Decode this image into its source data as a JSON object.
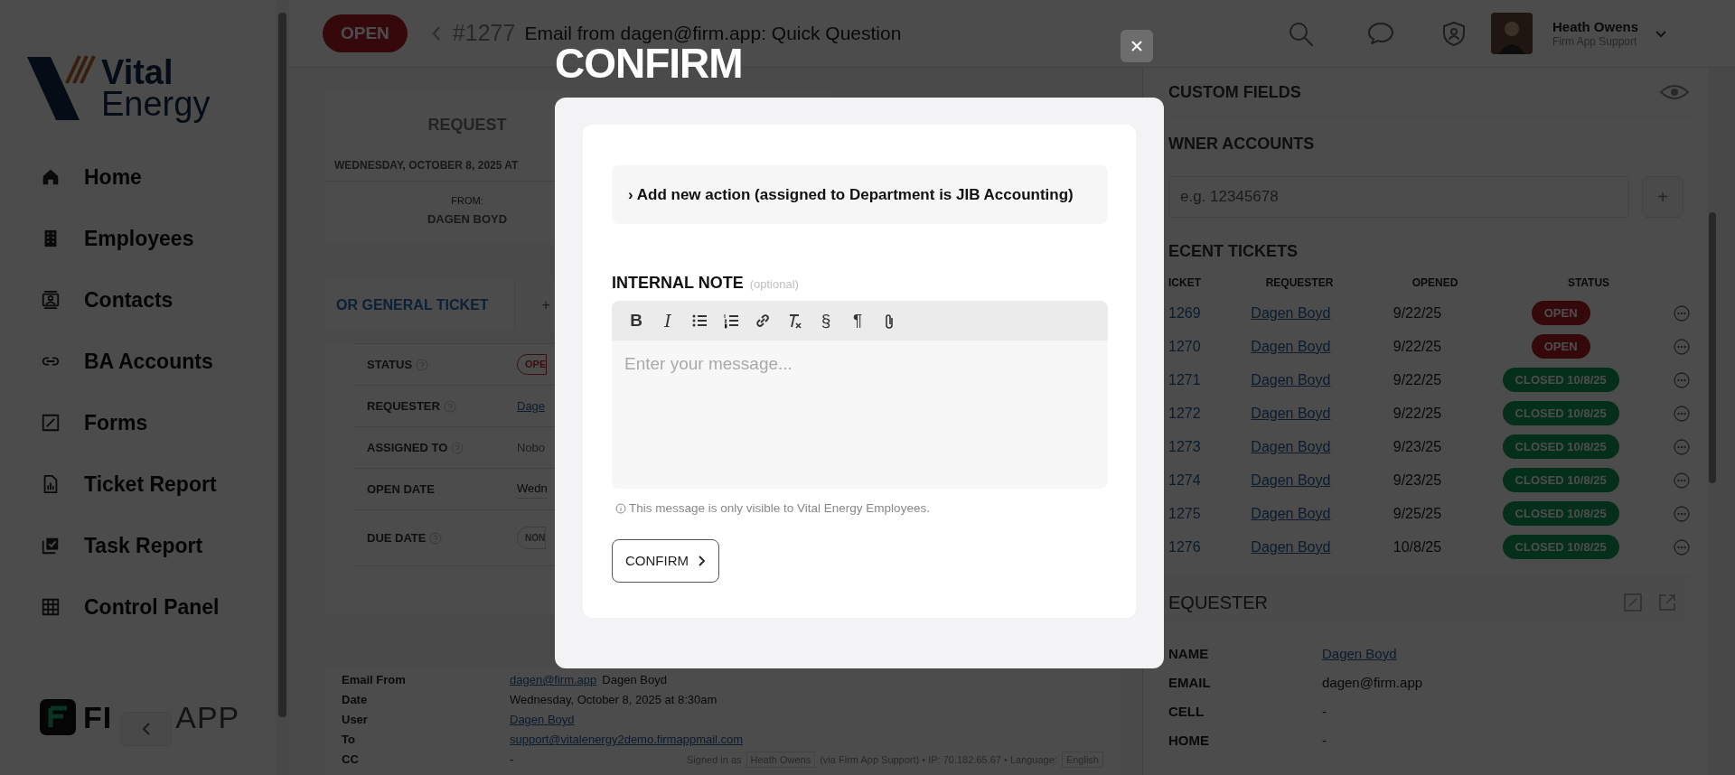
{
  "sidebar": {
    "logo": {
      "line_1": "Vital",
      "line_2": "Energy"
    },
    "items": [
      {
        "label": "Home"
      },
      {
        "label": "Employees"
      },
      {
        "label": "Contacts"
      },
      {
        "label": "BA Accounts"
      },
      {
        "label": "Forms"
      },
      {
        "label": "Ticket Report"
      },
      {
        "label": "Task Report"
      },
      {
        "label": "Control Panel"
      }
    ],
    "footer_logo": {
      "part_1": "FI",
      "part_2": "APP"
    }
  },
  "header": {
    "status": "OPEN",
    "ticket_number": "#1277",
    "title": "Email from dagen@firm.app: Quick Question",
    "user": {
      "name": "Heath Owens",
      "subtitle": "Firm App Support"
    }
  },
  "request": {
    "heading": "REQUEST",
    "date": "WEDNESDAY, OCTOBER 8, 2025 AT",
    "from_label": "FROM:",
    "from": "DAGEN BOYD"
  },
  "tabs": [
    {
      "label": "OR GENERAL TICKET",
      "selected": true
    },
    {
      "label": "+",
      "selected": false
    }
  ],
  "details": [
    {
      "label": "STATUS",
      "help": true,
      "kind": "status",
      "value": "OPE"
    },
    {
      "label": "REQUESTER",
      "help": true,
      "kind": "link",
      "value": "Dage"
    },
    {
      "label": "ASSIGNED TO",
      "help": true,
      "kind": "muted",
      "value": "Nobo"
    },
    {
      "label": "OPEN DATE",
      "help": false,
      "kind": "text",
      "value": "Wedn"
    },
    {
      "label": "DUE DATE",
      "help": true,
      "kind": "pill",
      "value": "NON"
    }
  ],
  "email_meta": [
    {
      "label": "Email From",
      "link": "dagen@firm.app",
      "value": "Dagen Boyd"
    },
    {
      "label": "Date",
      "value": "Wednesday, October 8, 2025 at 8:30am"
    },
    {
      "label": "User",
      "link": "Dagen Boyd"
    },
    {
      "label": "To",
      "link": "support@vitalenergy2demo.firmappmail.com"
    },
    {
      "label": "CC",
      "value": "-"
    }
  ],
  "footer": {
    "signed_in": "Signed in as",
    "user": "Heath Owens",
    "details": "(via Firm App Support) • IP: 70.182.65.67 • Language:",
    "language": "English"
  },
  "right_panel": {
    "custom_fields": "CUSTOM FIELDS",
    "owner_accounts": {
      "heading": "WNER ACCOUNTS",
      "placeholder": "e.g. 12345678",
      "add": "+"
    },
    "recent_tickets": {
      "heading": "ECENT TICKETS",
      "columns": [
        "ICKET",
        "REQUESTER",
        "OPENED",
        "STATUS"
      ],
      "rows": [
        {
          "ticket": "1269",
          "requester": "Dagen Boyd",
          "opened": "9/22/25",
          "status": "OPEN",
          "kind": "open"
        },
        {
          "ticket": "1270",
          "requester": "Dagen Boyd",
          "opened": "9/22/25",
          "status": "OPEN",
          "kind": "open"
        },
        {
          "ticket": "1271",
          "requester": "Dagen Boyd",
          "opened": "9/22/25",
          "status": "CLOSED 10/8/25",
          "kind": "closed"
        },
        {
          "ticket": "1272",
          "requester": "Dagen Boyd",
          "opened": "9/22/25",
          "status": "CLOSED 10/8/25",
          "kind": "closed"
        },
        {
          "ticket": "1273",
          "requester": "Dagen Boyd",
          "opened": "9/23/25",
          "status": "CLOSED 10/8/25",
          "kind": "closed"
        },
        {
          "ticket": "1274",
          "requester": "Dagen Boyd",
          "opened": "9/23/25",
          "status": "CLOSED 10/8/25",
          "kind": "closed"
        },
        {
          "ticket": "1275",
          "requester": "Dagen Boyd",
          "opened": "9/25/25",
          "status": "CLOSED 10/8/25",
          "kind": "closed"
        },
        {
          "ticket": "1276",
          "requester": "Dagen Boyd",
          "opened": "10/8/25",
          "status": "CLOSED 10/8/25",
          "kind": "closed"
        }
      ]
    },
    "requester": {
      "heading": "EQUESTER",
      "rows": [
        {
          "label": "NAME",
          "value": "Dagen Boyd",
          "link": true
        },
        {
          "label": "EMAIL",
          "value": "dagen@firm.app",
          "link": false
        },
        {
          "label": "CELL",
          "value": "-",
          "link": false
        },
        {
          "label": "HOME",
          "value": "-",
          "link": false
        }
      ]
    }
  },
  "modal": {
    "title": "CONFIRM",
    "action": "› Add new action (assigned to Department is JIB Accounting)",
    "note_label": "INTERNAL NOTE",
    "note_hint": "(optional)",
    "toolbar": [
      {
        "kind": "bold",
        "label": "B"
      },
      {
        "kind": "italic",
        "label": "I"
      },
      {
        "kind": "bullet_list"
      },
      {
        "kind": "numbered_list"
      },
      {
        "kind": "link"
      },
      {
        "kind": "clear_format"
      },
      {
        "kind": "glyph",
        "label": "§"
      },
      {
        "kind": "glyph",
        "label": "¶"
      },
      {
        "kind": "attach"
      }
    ],
    "placeholder": "Enter your message...",
    "help": "This message is only visible to Vital Energy Employees.",
    "button": "CONFIRM"
  }
}
